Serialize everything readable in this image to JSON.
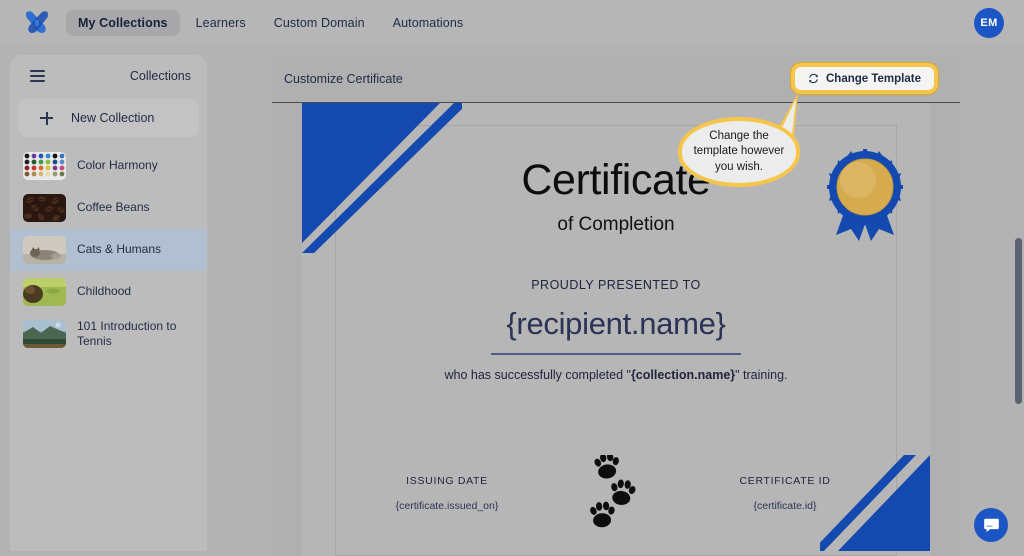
{
  "topnav": {
    "logo_icon": "brand-logo-icon",
    "links": [
      {
        "label": "My Collections",
        "active": true
      },
      {
        "label": "Learners",
        "active": false
      },
      {
        "label": "Custom Domain",
        "active": false
      },
      {
        "label": "Automations",
        "active": false
      }
    ],
    "avatar_initials": "EM"
  },
  "sidebar": {
    "menu_icon": "hamburger-icon",
    "title": "Collections",
    "new_collection": {
      "icon": "plus-icon",
      "label": "New Collection"
    },
    "items": [
      {
        "label": "Color Harmony",
        "thumb": "color-dots-thumbnail",
        "selected": false
      },
      {
        "label": "Coffee Beans",
        "thumb": "coffee-beans-thumbnail",
        "selected": false
      },
      {
        "label": "Cats & Humans",
        "thumb": "cat-thumbnail",
        "selected": true
      },
      {
        "label": "Childhood",
        "thumb": "field-thumbnail",
        "selected": false
      },
      {
        "label": "101 Introduction to Tennis",
        "thumb": "landscape-thumbnail",
        "selected": false
      }
    ]
  },
  "main": {
    "title": "Customize Certificate",
    "change_template": {
      "label": "Change Template",
      "icon": "refresh-icon",
      "highlight_color": "#f6c64b"
    }
  },
  "callout": {
    "text": "Change the template however you wish.",
    "border_color": "#f6c64b",
    "background": "#ececec"
  },
  "certificate": {
    "title": "Certificate",
    "subtitle": "of Completion",
    "presented_label": "PROUDLY PRESENTED TO",
    "recipient": "{recipient.name}",
    "completion_prefix": "who has successfully completed \"",
    "completion_collection": "{collection.name}",
    "completion_suffix": "\" training.",
    "issuing_date_label": "ISSUING DATE",
    "issuing_date_value": "{certificate.issued_on}",
    "certificate_id_label": "CERTIFICATE ID",
    "certificate_id_value": "{certificate.id}",
    "seal_icon": "award-seal-icon",
    "paw_icon": "paw-prints-icon",
    "accent_color": "#1449b0",
    "gold_color": "#d5ab4e"
  },
  "chat": {
    "icon": "chat-bubble-icon",
    "color": "#1b56c4"
  }
}
